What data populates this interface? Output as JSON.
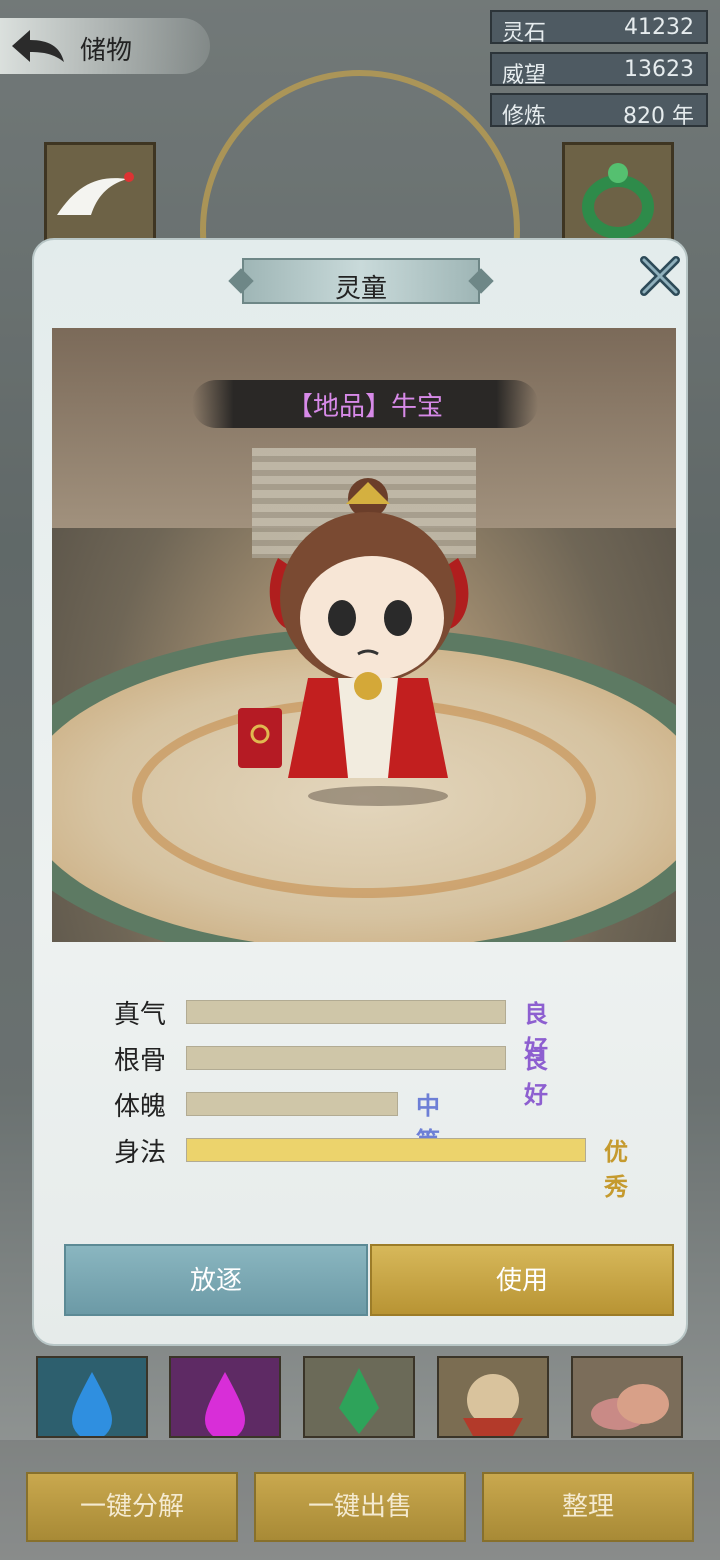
{
  "header": {
    "back_label": "储物"
  },
  "resources": [
    {
      "label": "灵石",
      "value": "41232"
    },
    {
      "label": "威望",
      "value": "13623"
    },
    {
      "label": "修炼",
      "value": "820 年"
    }
  ],
  "modal": {
    "title": "灵童",
    "character_name": "【地品】牛宝",
    "stats": [
      {
        "name": "真气",
        "grade": "良好",
        "level": 0.8,
        "grade_color": "#8d5fd0"
      },
      {
        "name": "根骨",
        "grade": "良好",
        "level": 0.8,
        "grade_color": "#8d5fd0"
      },
      {
        "name": "体魄",
        "grade": "中等",
        "level": 0.53,
        "grade_color": "#6d7fd6"
      },
      {
        "name": "身法",
        "grade": "优秀",
        "level": 1.0,
        "grade_color": "#c59a2e"
      }
    ],
    "buttons": {
      "exile": "放逐",
      "use": "使用"
    }
  },
  "bottom_actions": {
    "decompose": "一键分解",
    "sell": "一键出售",
    "sort": "整理"
  },
  "colors": {
    "accent_gold": "#c9a84e",
    "accent_teal": "#7aa8b2",
    "modal_bg": "#e6ecec"
  }
}
